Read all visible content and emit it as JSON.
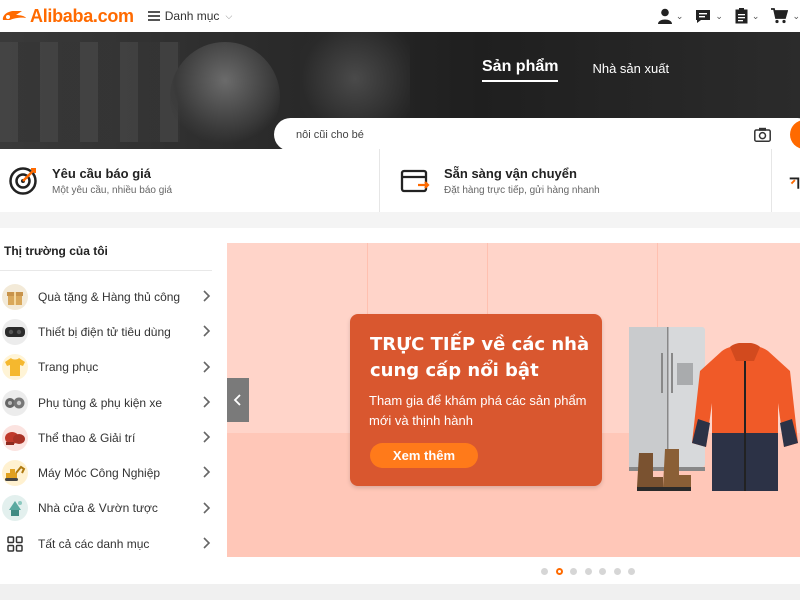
{
  "header": {
    "logo_text": "Alibaba.com",
    "category_menu_label": "Danh mục",
    "icons": [
      "user-icon",
      "message-icon",
      "orders-icon",
      "cart-icon"
    ]
  },
  "hero": {
    "tabs": [
      {
        "label": "Sản phẩm",
        "active": true
      },
      {
        "label": "Nhà sản xuất",
        "active": false
      }
    ],
    "search_value": "nôi cũi cho bé",
    "camera_icon": "camera-icon"
  },
  "features": [
    {
      "icon": "target-icon",
      "title": "Yêu cầu báo giá",
      "subtitle": "Một yêu cầu, nhiều báo giá"
    },
    {
      "icon": "shipping-box-icon",
      "title": "Sẵn sàng vận chuyển",
      "subtitle": "Đặt hàng trực tiếp, gửi hàng nhanh"
    }
  ],
  "sidebar": {
    "title": "Thị trường của tôi",
    "items": [
      {
        "label": "Quà tặng & Hàng thủ công",
        "icon": "gift-crafts-icon"
      },
      {
        "label": "Thiết bị điện tử tiêu dùng",
        "icon": "vr-headset-icon"
      },
      {
        "label": "Trang phục",
        "icon": "tshirt-icon"
      },
      {
        "label": "Phụ tùng & phụ kiện xe",
        "icon": "car-parts-icon"
      },
      {
        "label": "Thể thao & Giải trí",
        "icon": "boxing-glove-icon"
      },
      {
        "label": "Máy Móc Công Nghiệp",
        "icon": "excavator-icon"
      },
      {
        "label": "Nhà cửa & Vườn tược",
        "icon": "garden-icon"
      },
      {
        "label": "Tất cả các danh mục",
        "icon": "grid-icon"
      }
    ]
  },
  "banner": {
    "headline": "TRỰC TIẾP về các nhà cung cấp nổi bật",
    "body": "Tham gia để khám phá các sản phẩm mới và thịnh hành",
    "cta_label": "Xem thêm",
    "slides": 7,
    "active_slide": 2
  },
  "colors": {
    "brand": "#ff6a00",
    "promo_panel": "#d9572f",
    "banner_bg": "#ffd4c9"
  }
}
